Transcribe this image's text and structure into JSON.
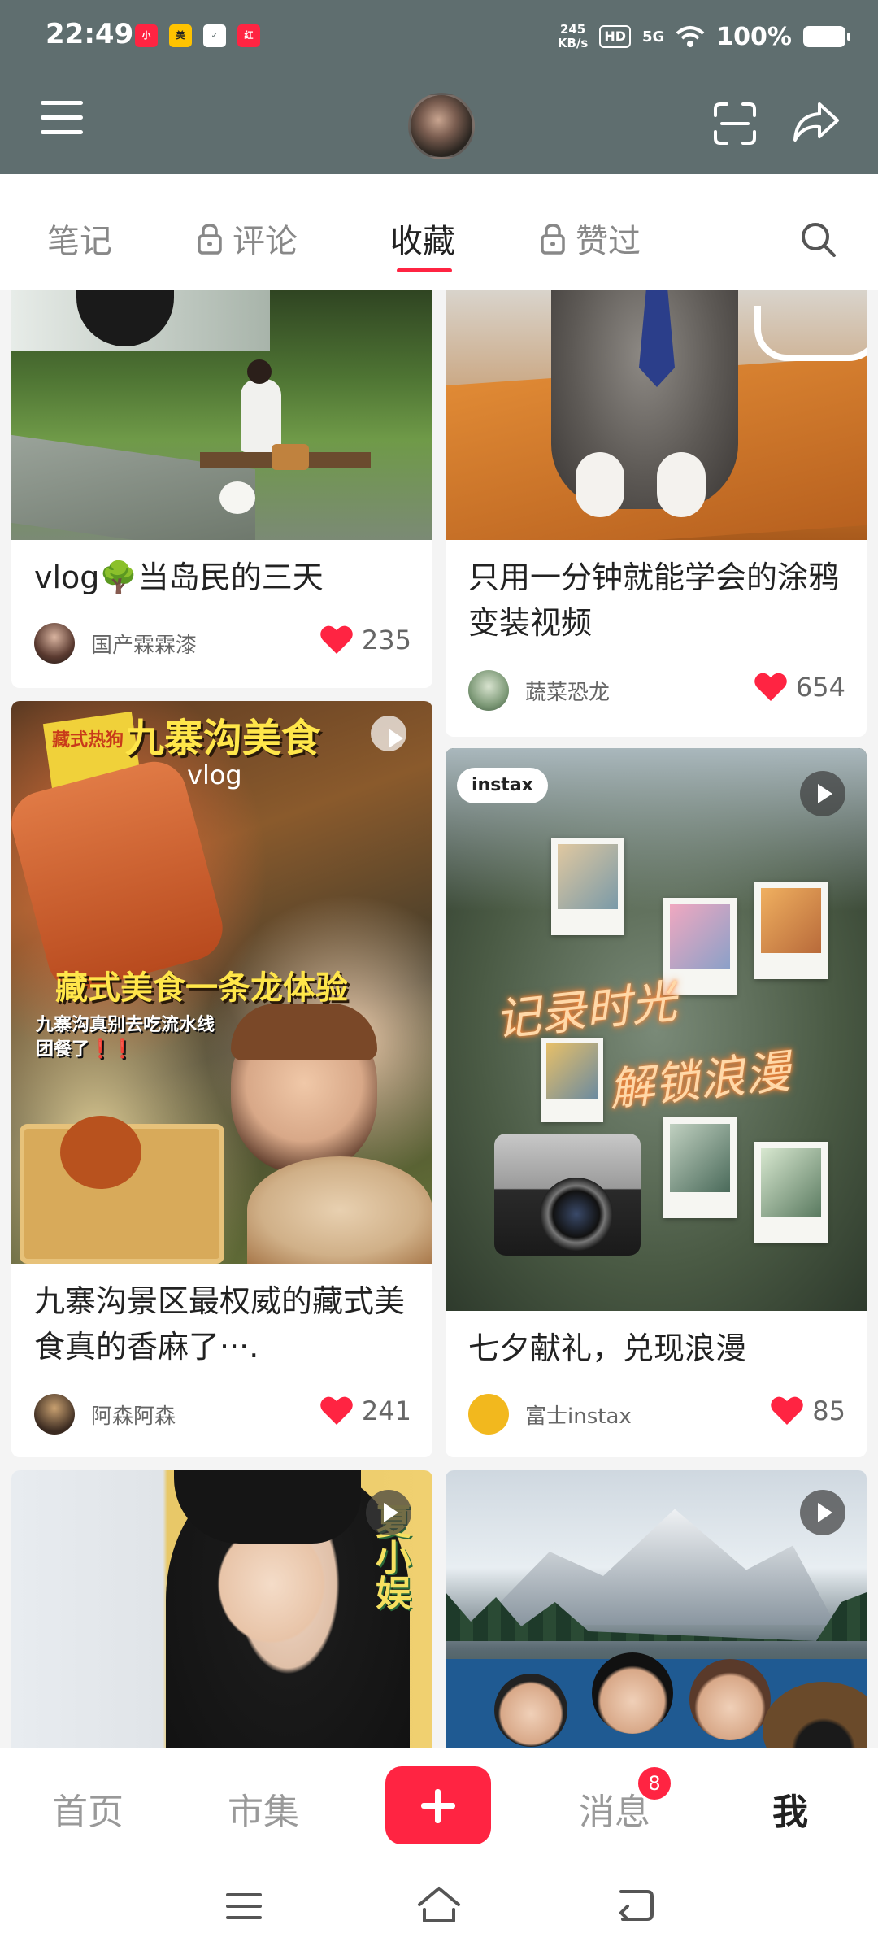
{
  "status": {
    "time": "22:49",
    "net_speed_value": "245",
    "net_speed_unit": "KB/s",
    "hd": "HD",
    "signal": "5G",
    "battery": "100%"
  },
  "tabs": {
    "notes": "笔记",
    "comments": "评论",
    "favorites": "收藏",
    "liked": "赞过"
  },
  "cards": [
    {
      "title": "vlog🌳当岛民的三天",
      "author": "国产霖霖漆",
      "likes": "235"
    },
    {
      "title": "只用一分钟就能学会的涂鸦变装视频",
      "author": "蔬菜恐龙",
      "likes": "654"
    },
    {
      "title": "九寨沟景区最权威的藏式美食真的香麻了···.",
      "author": "阿森阿森",
      "likes": "241",
      "img_text": {
        "headline": "九寨沟美食",
        "vlog": "vlog",
        "main": "藏式美食一条龙体验",
        "sub": "九寨沟真别去吃流水线团餐了❗❗",
        "box": "藏式热狗"
      }
    },
    {
      "title": "七夕献礼，兑现浪漫",
      "author": "富士instax",
      "likes": "85",
      "img_text": {
        "brand": "instax",
        "line1": "记录时光",
        "line2": "解锁浪漫"
      }
    },
    {
      "img_text": {
        "side": "夏小娱"
      }
    },
    {}
  ],
  "nav": {
    "home": "首页",
    "market": "市集",
    "messages": "消息",
    "messages_badge": "8",
    "me": "我"
  },
  "colors": {
    "accent": "#ff2442",
    "topbar": "#5f6e6f"
  }
}
